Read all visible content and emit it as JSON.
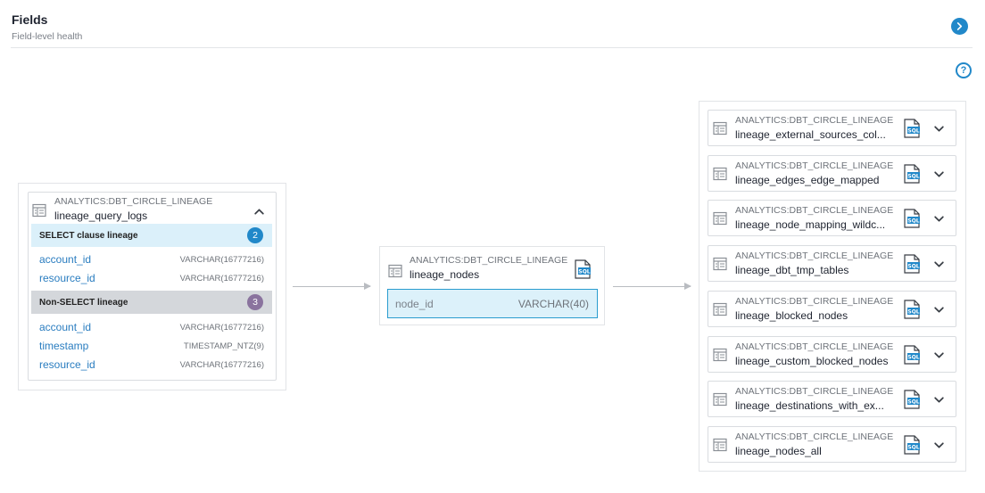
{
  "header": {
    "title": "Fields",
    "subtitle": "Field-level health"
  },
  "colors": {
    "accent": "#2188c9",
    "select_bar": "#dbf0fa",
    "non_select_bar": "#d4d7db",
    "select_badge": "#2188c9",
    "non_select_badge": "#8a739e"
  },
  "source": {
    "schema": "ANALYTICS:DBT_CIRCLE_LINEAGE",
    "table": "lineage_query_logs",
    "select_group": {
      "label": "SELECT clause lineage",
      "count": "2",
      "fields": [
        {
          "name": "account_id",
          "type": "VARCHAR(16777216)"
        },
        {
          "name": "resource_id",
          "type": "VARCHAR(16777216)"
        }
      ]
    },
    "non_select_group": {
      "label": "Non-SELECT lineage",
      "count": "3",
      "fields": [
        {
          "name": "account_id",
          "type": "VARCHAR(16777216)"
        },
        {
          "name": "timestamp",
          "type": "TIMESTAMP_NTZ(9)"
        },
        {
          "name": "resource_id",
          "type": "VARCHAR(16777216)"
        }
      ]
    }
  },
  "target": {
    "schema": "ANALYTICS:DBT_CIRCLE_LINEAGE",
    "table": "lineage_nodes",
    "field": {
      "name": "node_id",
      "type": "VARCHAR(40)"
    }
  },
  "downstream": [
    {
      "schema": "ANALYTICS:DBT_CIRCLE_LINEAGE",
      "table": "lineage_external_sources_col..."
    },
    {
      "schema": "ANALYTICS:DBT_CIRCLE_LINEAGE",
      "table": "lineage_edges_edge_mapped"
    },
    {
      "schema": "ANALYTICS:DBT_CIRCLE_LINEAGE",
      "table": "lineage_node_mapping_wildc..."
    },
    {
      "schema": "ANALYTICS:DBT_CIRCLE_LINEAGE",
      "table": "lineage_dbt_tmp_tables"
    },
    {
      "schema": "ANALYTICS:DBT_CIRCLE_LINEAGE",
      "table": "lineage_blocked_nodes"
    },
    {
      "schema": "ANALYTICS:DBT_CIRCLE_LINEAGE",
      "table": "lineage_custom_blocked_nodes"
    },
    {
      "schema": "ANALYTICS:DBT_CIRCLE_LINEAGE",
      "table": "lineage_destinations_with_ex..."
    },
    {
      "schema": "ANALYTICS:DBT_CIRCLE_LINEAGE",
      "table": "lineage_nodes_all"
    }
  ],
  "icons": {
    "collapse": "chevron-up-icon",
    "expand": "chevron-down-icon",
    "next": "chevron-right-icon",
    "help": "question-mark-icon",
    "table": "table-icon",
    "sql": "sql-file-icon"
  },
  "help_glyph": "?",
  "sql_label": "SQL"
}
